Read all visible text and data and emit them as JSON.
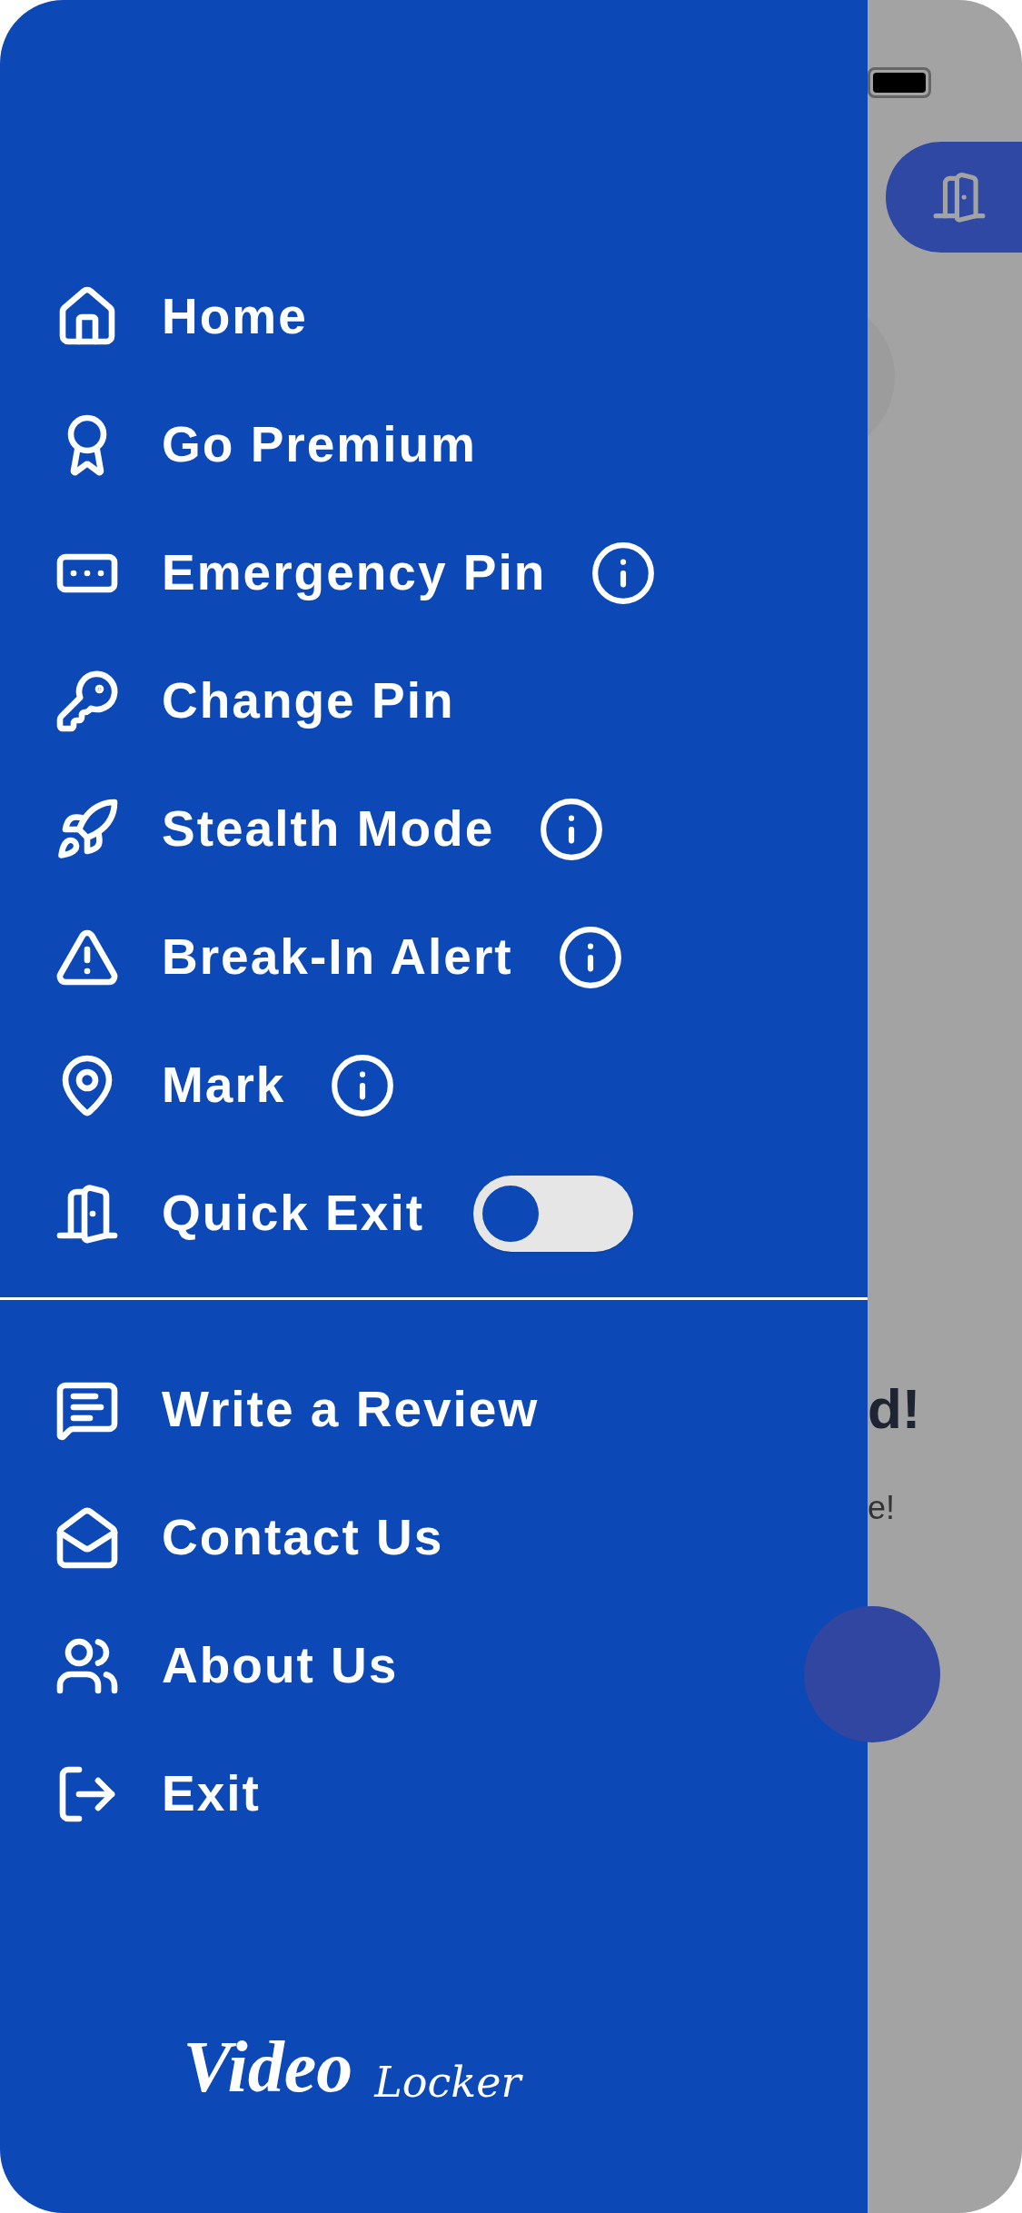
{
  "menu_top": [
    {
      "kind": "link",
      "label": "Home",
      "info": false
    },
    {
      "kind": "link",
      "label": "Go Premium",
      "info": false
    },
    {
      "kind": "link",
      "label": "Emergency Pin",
      "info": true
    },
    {
      "kind": "link",
      "label": "Change Pin",
      "info": false
    },
    {
      "kind": "link",
      "label": "Stealth Mode",
      "info": true
    },
    {
      "kind": "link",
      "label": "Break-In Alert",
      "info": true
    },
    {
      "kind": "link",
      "label": "Mark",
      "info": true
    },
    {
      "kind": "toggle",
      "label": "Quick Exit",
      "info": false,
      "on": false
    }
  ],
  "menu_bottom": [
    {
      "kind": "link",
      "label": "Write a Review",
      "info": false
    },
    {
      "kind": "link",
      "label": "Contact Us",
      "info": false
    },
    {
      "kind": "link",
      "label": "About Us",
      "info": false
    },
    {
      "kind": "link",
      "label": "Exit",
      "info": false
    }
  ],
  "logo": {
    "title": "Video",
    "subtitle": "Locker"
  },
  "background": {
    "heading": "d!",
    "subtext": "e!"
  }
}
